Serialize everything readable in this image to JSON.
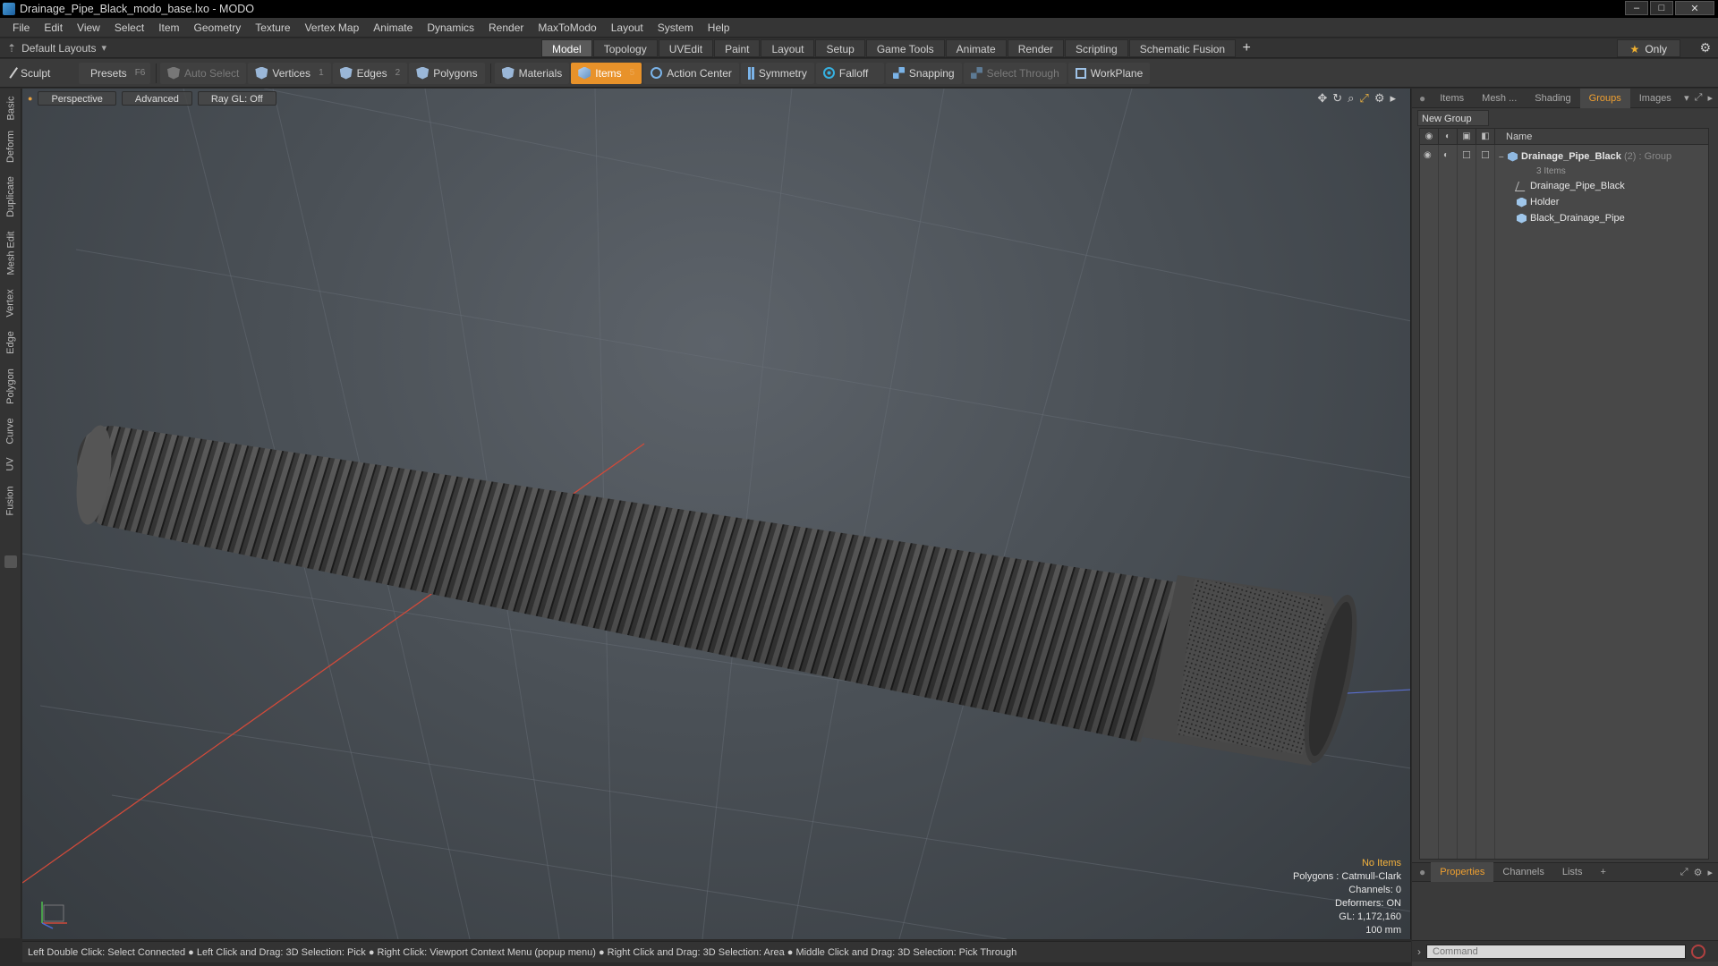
{
  "window": {
    "title": "Drainage_Pipe_Black_modo_base.lxo - MODO",
    "min": "–",
    "max": "□",
    "close": "✕"
  },
  "menu": [
    "File",
    "Edit",
    "View",
    "Select",
    "Item",
    "Geometry",
    "Texture",
    "Vertex Map",
    "Animate",
    "Dynamics",
    "Render",
    "MaxToModo",
    "Layout",
    "System",
    "Help"
  ],
  "layoutbar": {
    "layout_selector": "Default Layouts",
    "mode_tabs": [
      "Model",
      "Topology",
      "UVEdit",
      "Paint",
      "Layout",
      "Setup",
      "Game Tools",
      "Animate",
      "Render",
      "Scripting",
      "Schematic Fusion"
    ],
    "active_tab": "Model",
    "add": "+",
    "only": "Only"
  },
  "toolbar": {
    "sculpt": "Sculpt",
    "presets": "Presets",
    "presets_key": "F6",
    "auto_select": "Auto Select",
    "vertices": "Vertices",
    "vertices_key": "1",
    "edges": "Edges",
    "edges_key": "2",
    "polygons": "Polygons",
    "materials": "Materials",
    "items": "Items",
    "items_key": "5",
    "action_center": "Action Center",
    "symmetry": "Symmetry",
    "falloff": "Falloff",
    "snapping": "Snapping",
    "select_through": "Select Through",
    "workplane": "WorkPlane"
  },
  "left_tabs": [
    "Basic",
    "Deform",
    "Duplicate",
    "Mesh Edit",
    "Vertex",
    "Edge",
    "Polygon",
    "Curve",
    "UV",
    "Fusion"
  ],
  "viewport": {
    "view_mode": "Perspective",
    "shading": "Advanced",
    "raygl": "Ray GL: Off",
    "info": {
      "selection": "No Items",
      "polygons": "Polygons : Catmull-Clark",
      "channels": "Channels: 0",
      "deformers": "Deformers: ON",
      "gl": "GL: 1,172,160",
      "scale": "100 mm"
    }
  },
  "statusbar": "Left Double Click: Select Connected ● Left Click and Drag: 3D Selection: Pick ● Right Click: Viewport Context Menu (popup menu) ● Right Click and Drag: 3D Selection: Area ● Middle Click and Drag: 3D Selection: Pick Through",
  "right_panel": {
    "tabs": [
      "Items",
      "Mesh ...",
      "Shading",
      "Groups",
      "Images"
    ],
    "active_tab": "Groups",
    "new_group": "New Group",
    "name_col": "Name",
    "group": {
      "name": "Drainage_Pipe_Black",
      "count": "(2)",
      "type": ": Group",
      "sub": "3 Items"
    },
    "children": [
      "Drainage_Pipe_Black",
      "Holder",
      "Black_Drainage_Pipe"
    ],
    "bottom_tabs": [
      "Properties",
      "Channels",
      "Lists"
    ],
    "bottom_active": "Properties",
    "bottom_add": "+",
    "command_placeholder": "Command"
  },
  "colors": {
    "accent": "#e8922a",
    "warn": "#f5b33d"
  }
}
